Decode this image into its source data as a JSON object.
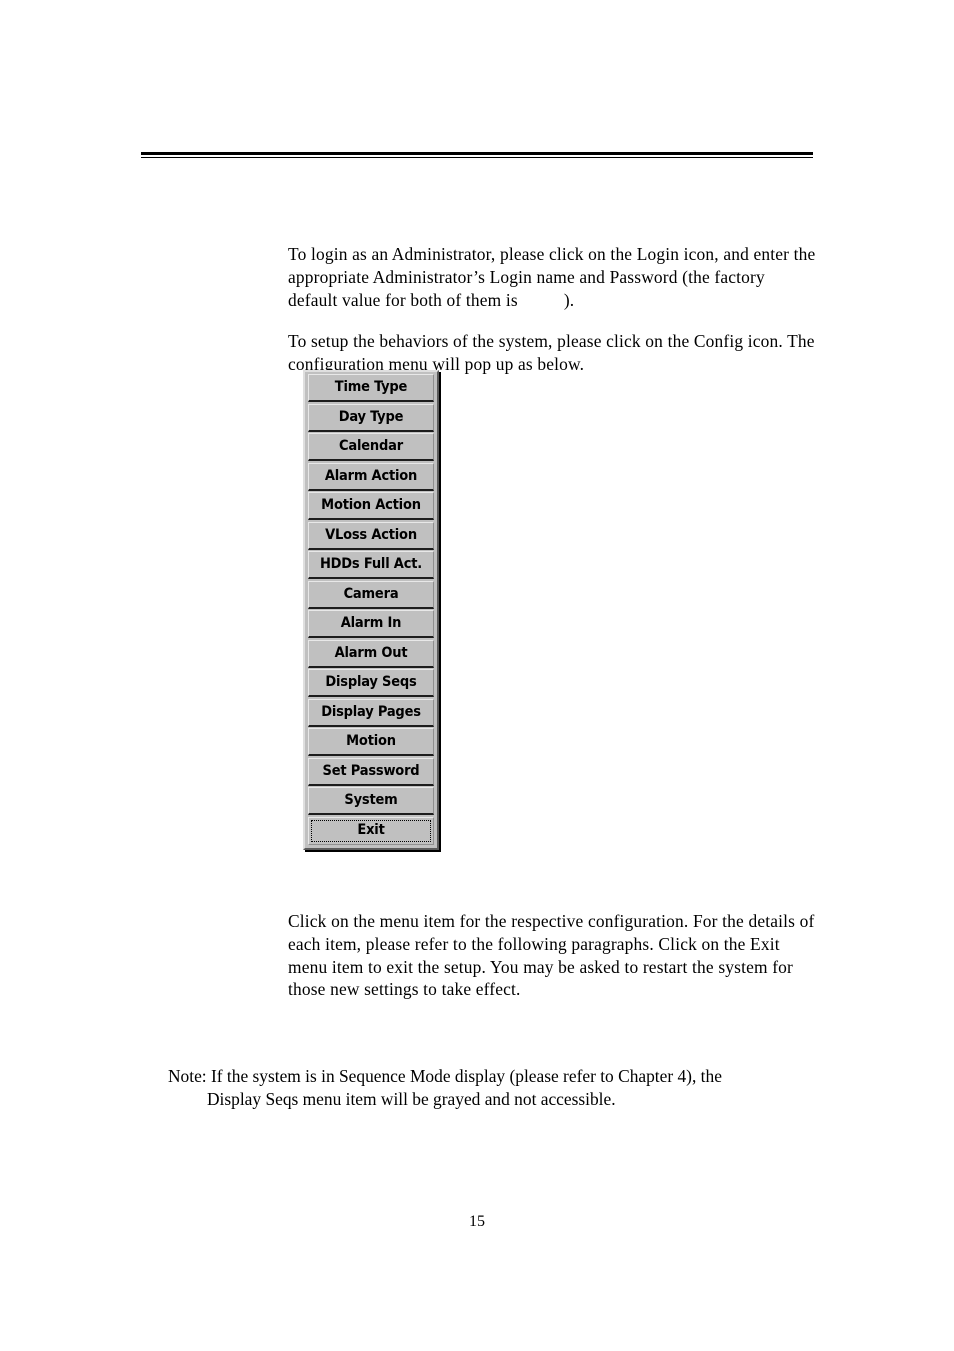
{
  "document": {
    "page_number": "15"
  },
  "body": {
    "para_login": "To login as an Administrator, please click on the Login icon, and enter the appropriate Administrator’s Login name and Password (the factory default value for both of them is",
    "para_login_tail": ").",
    "para_config": "To setup the behaviors of the system, please click on the Config icon. The configuration menu will pop up as below.",
    "para_clickmenu": "Click on the menu item for the respective configuration.    For the details of each item, please refer to the following paragraphs.    Click on the Exit menu item to exit the setup.    You may be asked to restart the system for those new settings to take effect."
  },
  "note": {
    "line1": "Note: If the system is in Sequence Mode display (please refer to Chapter 4), the",
    "line2": "Display Seqs menu item will be grayed and not accessible."
  },
  "config_menu": {
    "colors": {
      "face": "#c0c0c0",
      "highlight": "#e8e8e8",
      "shadow": "#5a5a5a",
      "dark": "#1c1c1c"
    },
    "items": [
      {
        "label": "Time Type",
        "focused": false
      },
      {
        "label": "Day Type",
        "focused": false
      },
      {
        "label": "Calendar",
        "focused": false
      },
      {
        "label": "Alarm Action",
        "focused": false
      },
      {
        "label": "Motion Action",
        "focused": false
      },
      {
        "label": "VLoss Action",
        "focused": false
      },
      {
        "label": "HDDs Full Act.",
        "focused": false
      },
      {
        "label": "Camera",
        "focused": false
      },
      {
        "label": "Alarm In",
        "focused": false
      },
      {
        "label": "Alarm Out",
        "focused": false
      },
      {
        "label": "Display Seqs",
        "focused": false
      },
      {
        "label": "Display Pages",
        "focused": false
      },
      {
        "label": "Motion",
        "focused": false
      },
      {
        "label": "Set Password",
        "focused": false
      },
      {
        "label": "System",
        "focused": false
      },
      {
        "label": "Exit",
        "focused": true
      }
    ]
  }
}
